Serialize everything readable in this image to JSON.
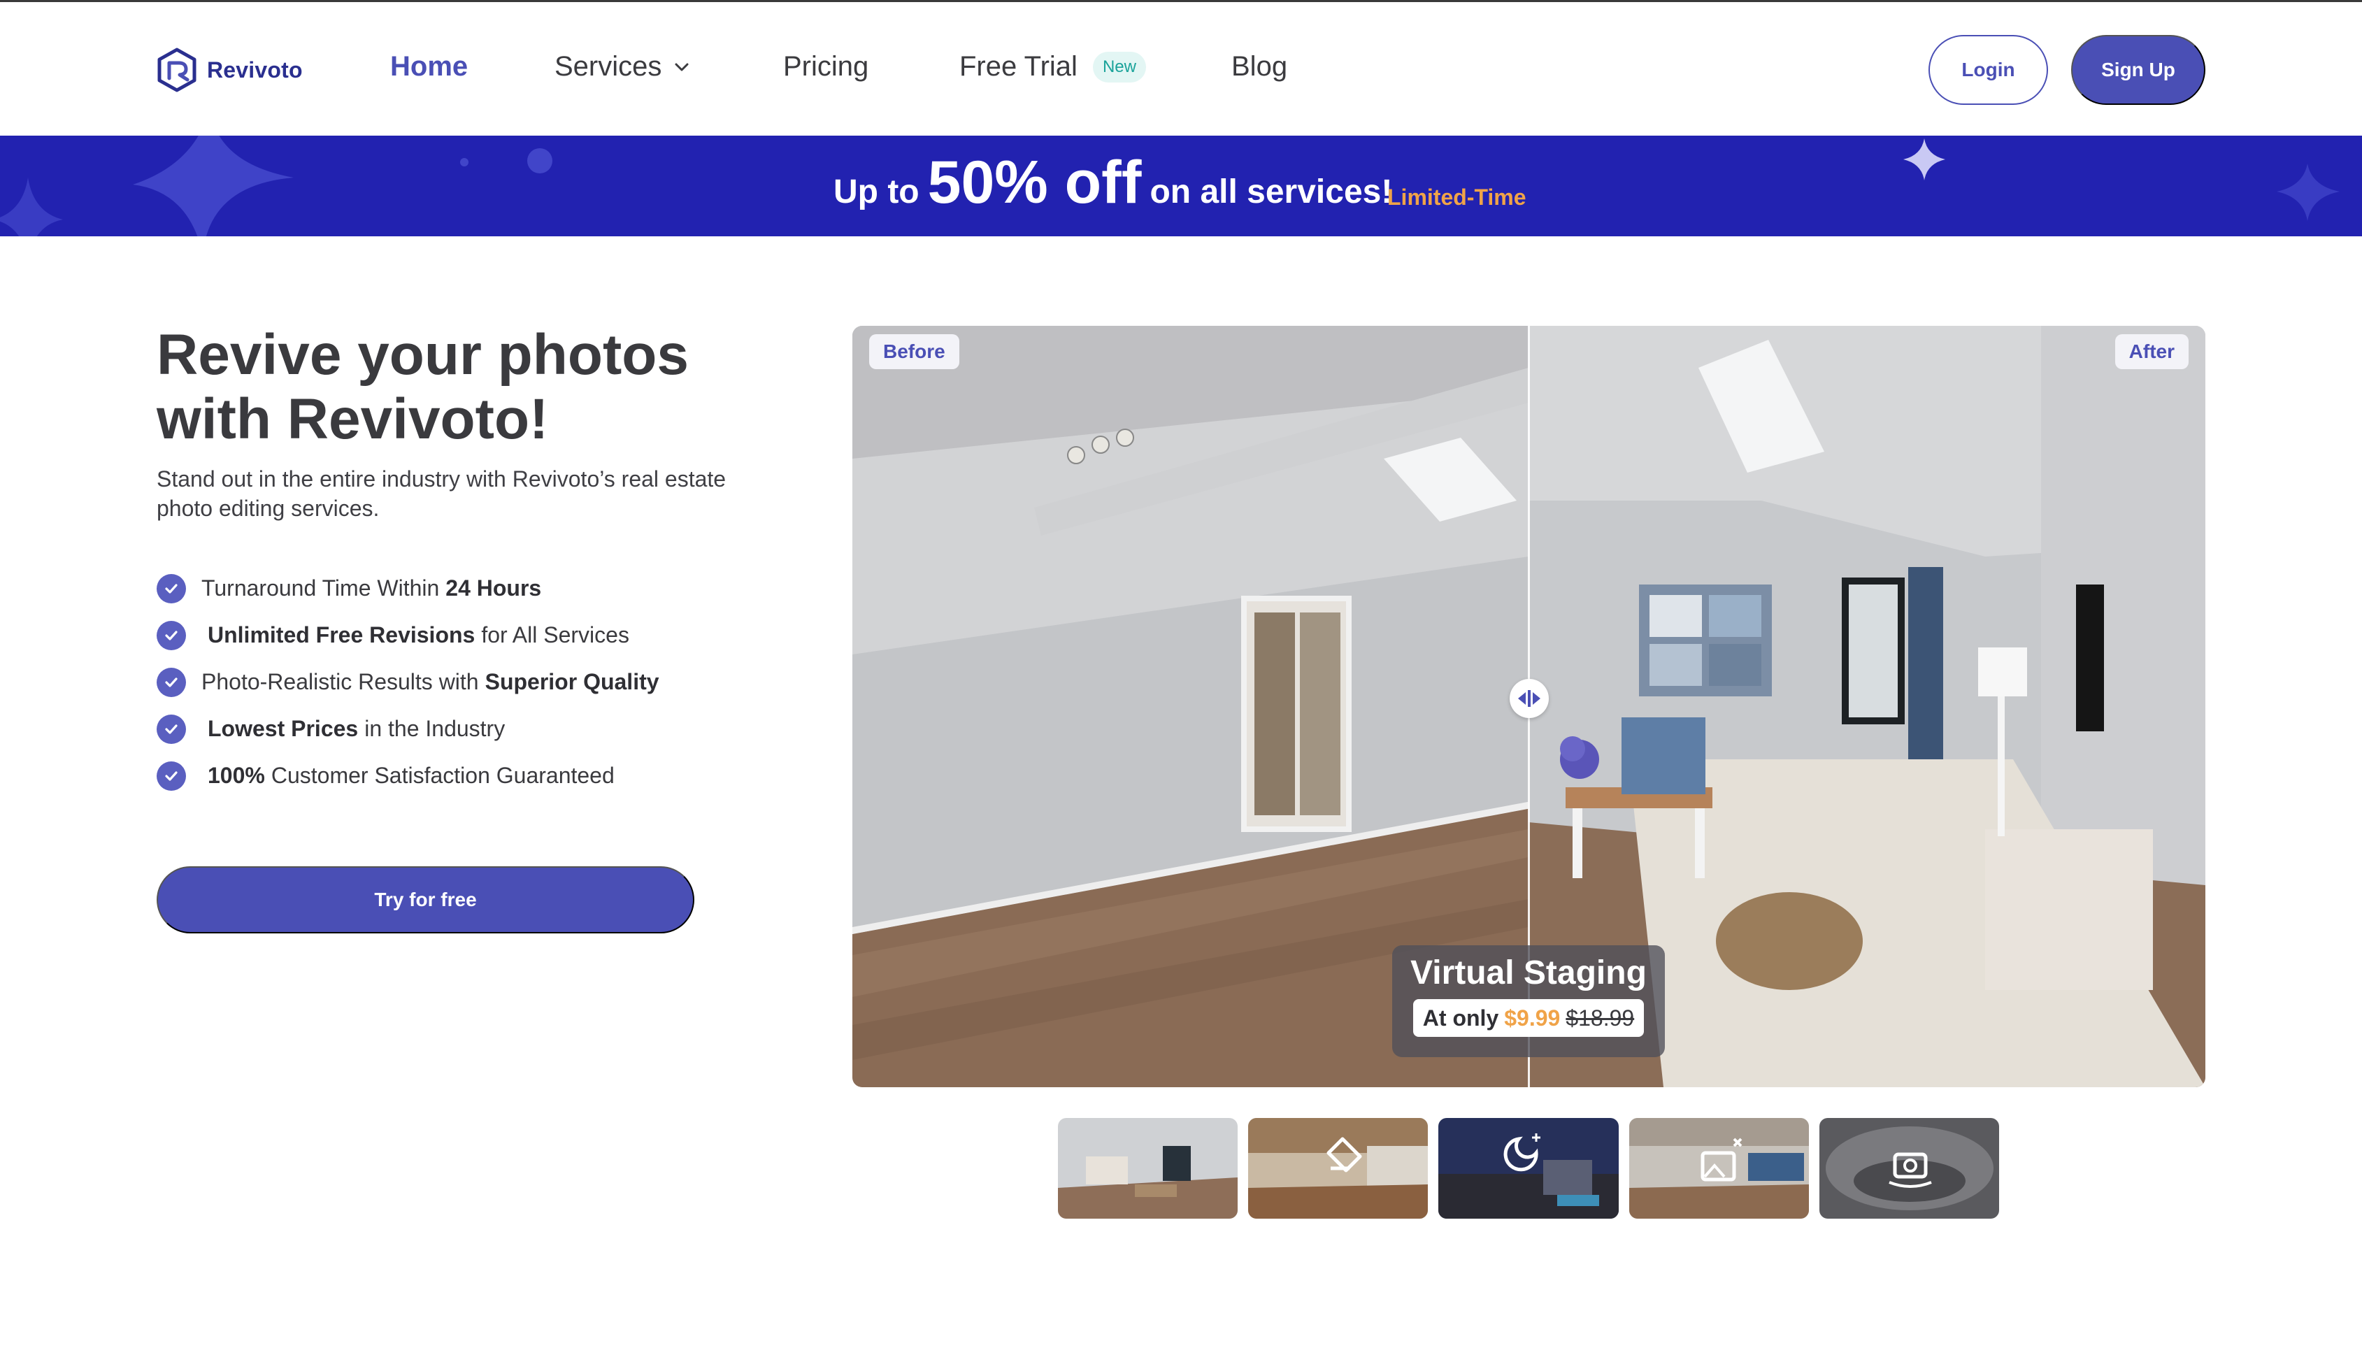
{
  "brand": {
    "name": "Revivoto",
    "color": "#2a2f8f",
    "accent": "#4a4fb5"
  },
  "nav": {
    "items": [
      {
        "label": "Home",
        "active": true
      },
      {
        "label": "Services",
        "has_dropdown": true
      },
      {
        "label": "Pricing"
      },
      {
        "label": "Free Trial",
        "badge": "New"
      },
      {
        "label": "Blog"
      }
    ],
    "login_label": "Login",
    "signup_label": "Sign Up"
  },
  "promo": {
    "prefix": "Up to",
    "amount": "50% off",
    "suffix": "on all services!",
    "tag": "Limited-Time",
    "bg_color": "#2222b0",
    "tag_color": "#f0a348"
  },
  "hero": {
    "title_line1": "Revive your photos",
    "title_line2": "with Revivoto!",
    "subtitle": "Stand out in the entire industry with Revivoto’s real estate photo editing services.",
    "features": [
      {
        "pre": "Turnaround Time Within",
        "bold": "24 Hours",
        "post": ""
      },
      {
        "pre": "",
        "bold": "Unlimited Free Revisions",
        "post": "for All Services"
      },
      {
        "pre": "Photo-Realistic Results with",
        "bold": "Superior Quality",
        "post": ""
      },
      {
        "pre": "",
        "bold": "Lowest Prices",
        "post": "in the Industry"
      },
      {
        "pre": "",
        "bold": "100%",
        "post": "Customer Satisfaction Guaranteed"
      }
    ],
    "cta_label": "Try for free"
  },
  "compare": {
    "before_label": "Before",
    "after_label": "After",
    "service_title": "Virtual Staging",
    "price_prefix": "At only",
    "price_now": "$9.99",
    "price_old": "$18.99"
  },
  "thumbnails": [
    {
      "icon": "none",
      "name": "virtual-staging"
    },
    {
      "icon": "eraser-icon",
      "name": "item-removal"
    },
    {
      "icon": "moon-icon",
      "name": "day-to-dusk"
    },
    {
      "icon": "image-sparkle-icon",
      "name": "photo-enhancement"
    },
    {
      "icon": "360-camera-icon",
      "name": "360-tour"
    }
  ]
}
